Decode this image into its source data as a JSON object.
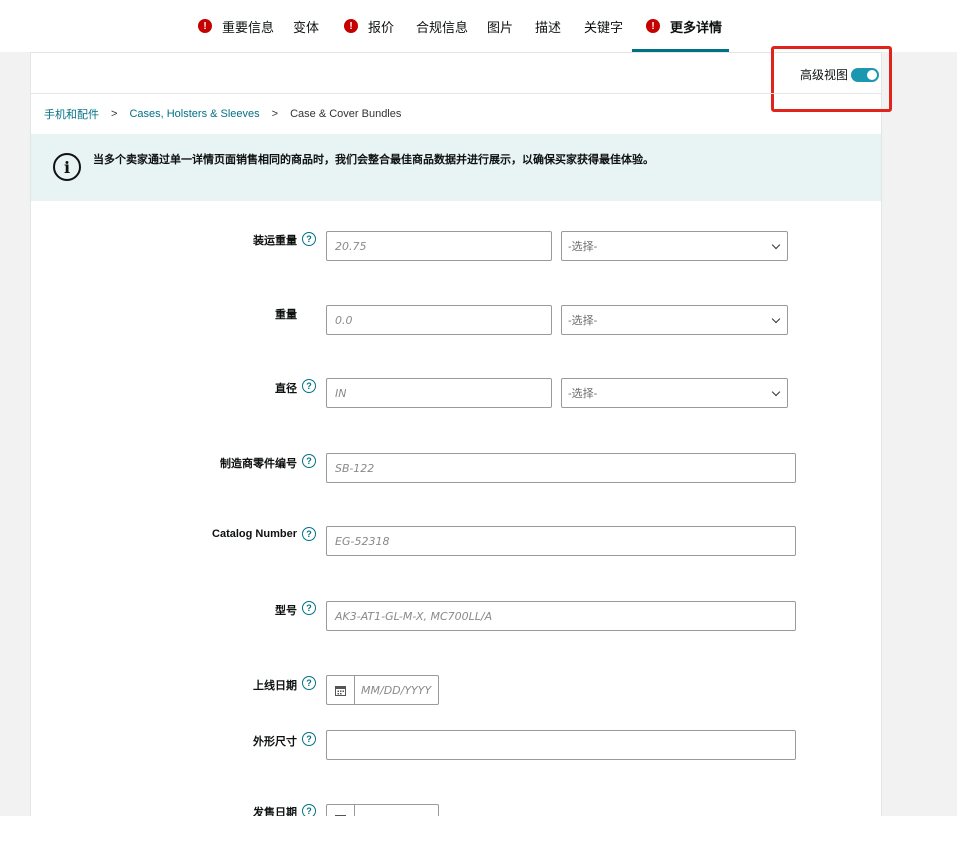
{
  "tabs": [
    {
      "label": "重要信息",
      "error": true,
      "active": false
    },
    {
      "label": "变体",
      "error": false,
      "active": false
    },
    {
      "label": "报价",
      "error": true,
      "active": false
    },
    {
      "label": "合规信息",
      "error": false,
      "active": false
    },
    {
      "label": "图片",
      "error": false,
      "active": false
    },
    {
      "label": "描述",
      "error": false,
      "active": false
    },
    {
      "label": "关键字",
      "error": false,
      "active": false
    },
    {
      "label": "更多详情",
      "error": true,
      "active": true
    }
  ],
  "error_icon": "!",
  "advanced_view": {
    "label": "高级视图",
    "enabled": true
  },
  "breadcrumb": {
    "items": [
      "手机和配件",
      "Cases, Holsters & Sleeves"
    ],
    "current": "Case & Cover Bundles",
    "separator": ">"
  },
  "info_banner": {
    "icon": "i",
    "text": "当多个卖家通过单一详情页面销售相同的商品时，我们会整合最佳商品数据并进行展示，以确保买家获得最佳体验。"
  },
  "help_glyph": "?",
  "fields": {
    "shipping_weight": {
      "label": "装运重量",
      "placeholder": "20.75",
      "unit": "-选择-"
    },
    "weight": {
      "label": "重量",
      "placeholder": "0.0",
      "unit": "-选择-"
    },
    "diameter": {
      "label": "直径",
      "placeholder": "IN",
      "unit": "-选择-"
    },
    "mfr_part_number": {
      "label": "制造商零件编号",
      "placeholder": "SB-122"
    },
    "catalog_number": {
      "label": "Catalog Number",
      "placeholder": "EG-52318"
    },
    "model_number": {
      "label": "型号",
      "placeholder": "AK3-AT1-GL-M-X, MC700LL/A"
    },
    "launch_date": {
      "label": "上线日期",
      "placeholder": "MM/DD/YYYY"
    },
    "form_factor": {
      "label": "外形尺寸",
      "placeholder": ""
    },
    "release_date": {
      "label": "发售日期",
      "placeholder": ""
    }
  }
}
